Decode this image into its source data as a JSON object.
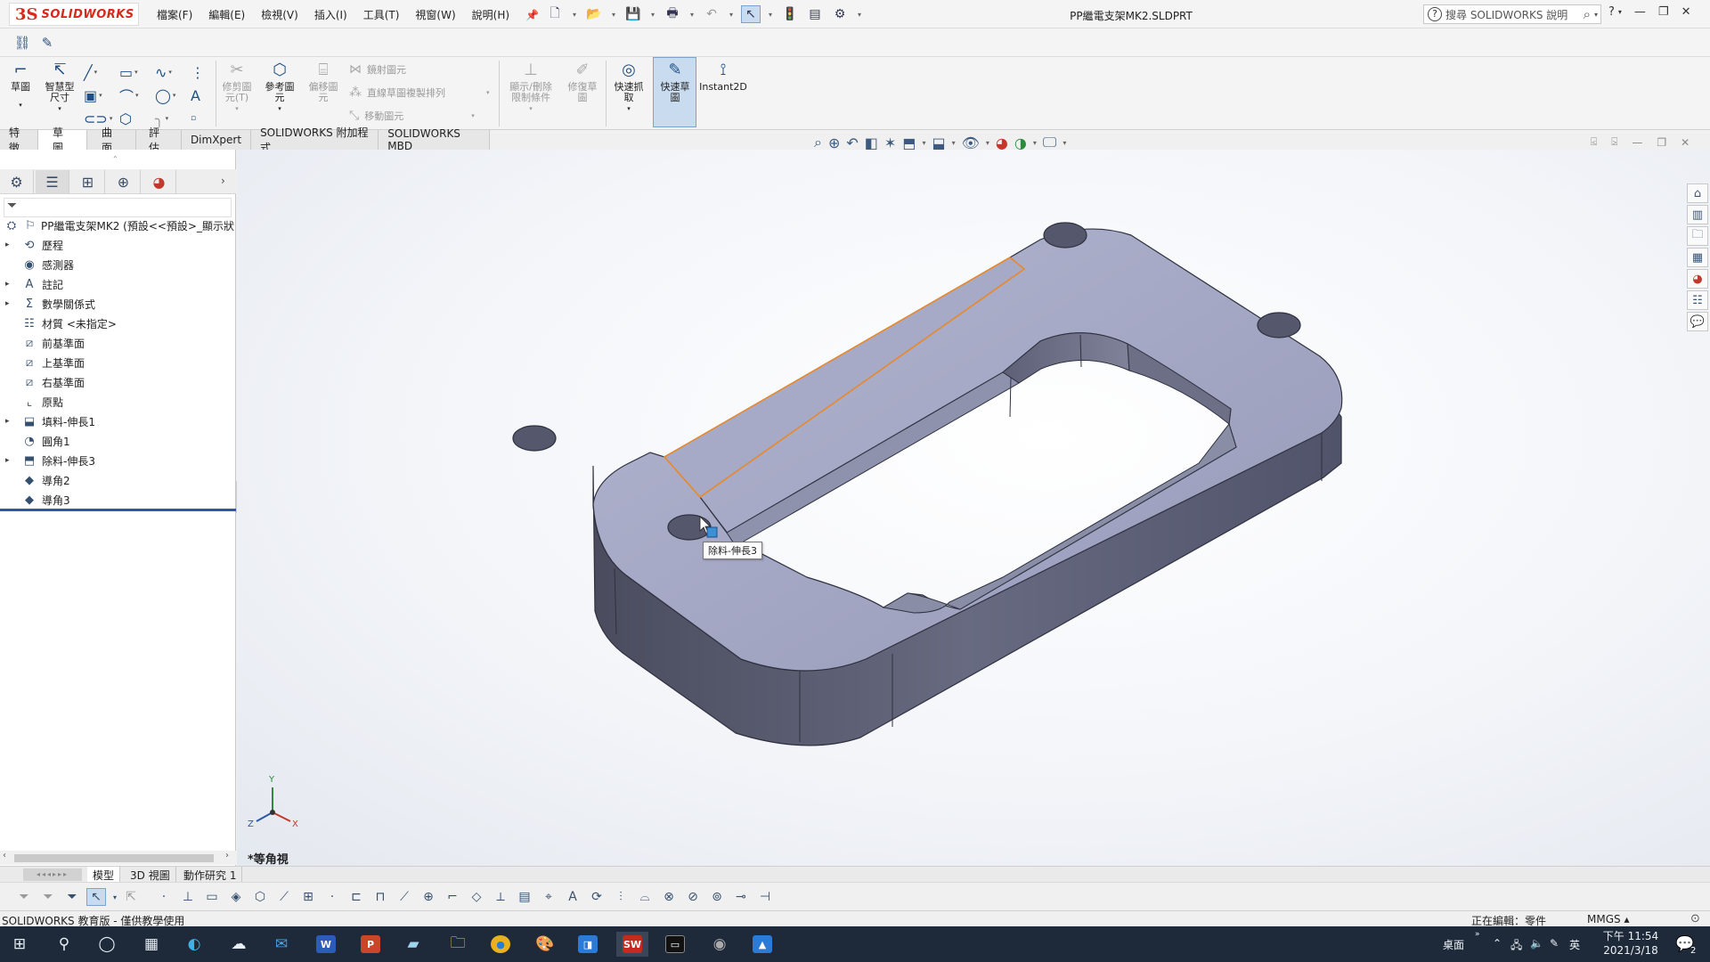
{
  "app": {
    "brand_logo_text": "SOLIDWORKS",
    "document_title": "PP繼電支架MK2.SLDPRT"
  },
  "menus": [
    "檔案(F)",
    "編輯(E)",
    "檢視(V)",
    "插入(I)",
    "工具(T)",
    "視窗(W)",
    "說明(H)"
  ],
  "help_search": {
    "placeholder": "搜尋 SOLIDWORKS 說明"
  },
  "command_manager": {
    "sketch": "草圖",
    "smart_dimension": "智慧型\n尺寸",
    "trim_entities": "修剪圖\n元(T)",
    "convert_entities": "參考圖\n元",
    "offset_entities": "偏移圖\n元",
    "mirror_entities": "鏡射圖元",
    "linear_pattern": "直線草圖複製排列",
    "move_entities": "移動圖元",
    "display_relations": "顯示/刪除\n限制條件",
    "repair_sketch": "修復草\n圖",
    "quick_snaps": "快速抓\n取",
    "rapid_sketch": "快速草\n圖",
    "instant2d": "Instant2D"
  },
  "tabs": [
    {
      "label": "特徵",
      "active": false
    },
    {
      "label": "草圖",
      "active": true
    },
    {
      "label": "曲面",
      "active": false
    },
    {
      "label": "評估",
      "active": false
    },
    {
      "label": "DimXpert",
      "active": false
    },
    {
      "label": "SOLIDWORKS 附加程式",
      "active": false
    },
    {
      "label": "SOLIDWORKS MBD",
      "active": false
    }
  ],
  "feature_tree": {
    "root": "PP繼電支架MK2 (預設<<預設>_顯示狀",
    "items": [
      {
        "label": "歷程",
        "icon": "history-icon",
        "expandable": true
      },
      {
        "label": "感測器",
        "icon": "sensor-icon",
        "expandable": false
      },
      {
        "label": "註記",
        "icon": "annotation-icon",
        "expandable": true
      },
      {
        "label": "數學關係式",
        "icon": "equation-icon",
        "expandable": true
      },
      {
        "label": "材質 <未指定>",
        "icon": "material-icon",
        "expandable": false
      },
      {
        "label": "前基準面",
        "icon": "plane-icon",
        "expandable": false
      },
      {
        "label": "上基準面",
        "icon": "plane-icon",
        "expandable": false
      },
      {
        "label": "右基準面",
        "icon": "plane-icon",
        "expandable": false
      },
      {
        "label": "原點",
        "icon": "origin-icon",
        "expandable": false
      },
      {
        "label": "填料-伸長1",
        "icon": "extrude-icon",
        "expandable": true
      },
      {
        "label": "圓角1",
        "icon": "fillet-icon",
        "expandable": false
      },
      {
        "label": "除料-伸長3",
        "icon": "cut-extrude-icon",
        "expandable": true
      },
      {
        "label": "導角2",
        "icon": "chamfer-icon",
        "expandable": false
      },
      {
        "label": "導角3",
        "icon": "chamfer-icon",
        "expandable": false
      }
    ]
  },
  "graphics": {
    "tooltip": "除料-伸長3",
    "view_name": "*等角視",
    "triad": {
      "x": "X",
      "y": "Y",
      "z": "Z"
    }
  },
  "bottom_tabs": [
    {
      "label": "模型",
      "active": true
    },
    {
      "label": "3D 視圖",
      "active": false
    },
    {
      "label": "動作研究 1",
      "active": false
    }
  ],
  "status_bar": {
    "left": "SOLIDWORKS 教育版 - 僅供教學使用",
    "editing": "正在編輯：零件",
    "units": "MMGS ▴"
  },
  "taskbar": {
    "tray_desktop": "桌面",
    "tray_ime": "英",
    "clock_time": "下午 11:54",
    "clock_date": "2021/3/18",
    "notifications": "2"
  },
  "colors": {
    "model_top": "#a3a6c4",
    "model_side": "#5c5f74",
    "highlight_edge": "#e8882a",
    "brand_red": "#d52b1e",
    "active_button": "#c9dcef"
  }
}
